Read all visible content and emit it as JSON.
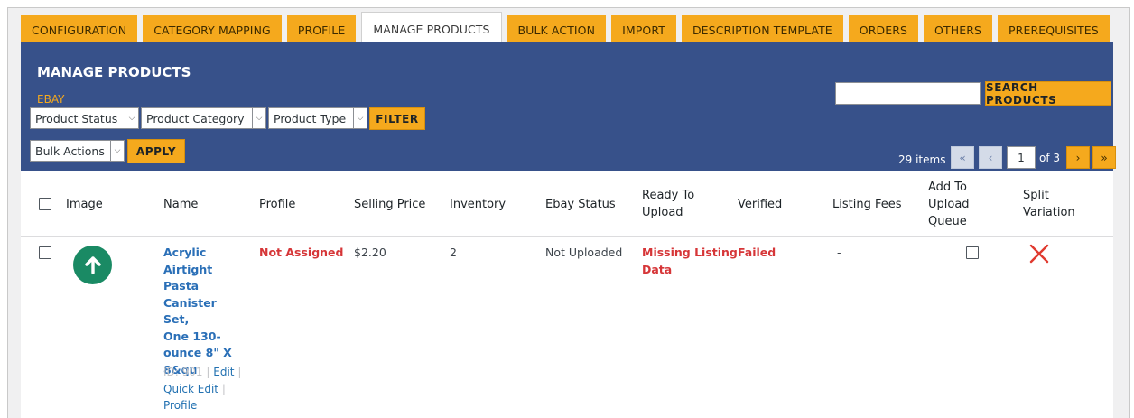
{
  "tabs": [
    {
      "label": "CONFIGURATION",
      "active": false
    },
    {
      "label": "CATEGORY MAPPING",
      "active": false
    },
    {
      "label": "PROFILE",
      "active": false
    },
    {
      "label": "MANAGE PRODUCTS",
      "active": true
    },
    {
      "label": "BULK ACTION",
      "active": false
    },
    {
      "label": "IMPORT",
      "active": false
    },
    {
      "label": "DESCRIPTION TEMPLATE",
      "active": false
    },
    {
      "label": "ORDERS",
      "active": false
    },
    {
      "label": "OTHERS",
      "active": false
    },
    {
      "label": "PREREQUISITES",
      "active": false
    }
  ],
  "page": {
    "title": "MANAGE PRODUCTS",
    "channel": "EBAY"
  },
  "filters": {
    "product_status": "Product Status",
    "product_category": "Product Category",
    "product_type": "Product Type",
    "filter_label": "FILTER"
  },
  "bulk": {
    "selected": "Bulk Actions",
    "apply_label": "APPLY"
  },
  "search": {
    "value": "",
    "button_label": "SEARCH PRODUCTS"
  },
  "pagination": {
    "items": "29 items",
    "first": "«",
    "prev": "‹",
    "current": "1",
    "of": "of 3",
    "next": "›",
    "last": "»"
  },
  "columns": {
    "image": "Image",
    "name": "Name",
    "profile": "Profile",
    "selling_price": "Selling Price",
    "inventory": "Inventory",
    "ebay_status": "Ebay Status",
    "ready_1": "Ready To",
    "ready_2": "Upload",
    "verified": "Verified",
    "listing_fees": "Listing Fees",
    "queue_1": "Add To",
    "queue_2": "Upload",
    "queue_3": "Queue",
    "split_1": "Split",
    "split_2": "Variation"
  },
  "rows": [
    {
      "name_lines": [
        "Acrylic",
        "Airtight",
        "Pasta",
        "Canister Set,",
        "One 130-",
        "ounce 8\" X",
        "8&qu"
      ],
      "id": "ID: 901",
      "sep": "|",
      "edit": "Edit",
      "quick_edit": "Quick Edit",
      "profile_link": "Profile",
      "profile": "Not Assigned",
      "selling_price": "$2.20",
      "inventory": "2",
      "ebay_status": "Not Uploaded",
      "ready_1": "Missing Listing",
      "ready_2": "Data",
      "verified": "Failed",
      "listing_fees": "-"
    }
  ],
  "colors": {
    "tab": "#f5a91d",
    "panel": "#37518a",
    "link": "#2a6fb7",
    "error": "#d63638",
    "image_bg": "#1a8a64"
  },
  "icons": {
    "product_image": "arrow-up-circle-icon",
    "split_variation": "red-x-icon",
    "dropdown": "chevron-down-icon"
  }
}
